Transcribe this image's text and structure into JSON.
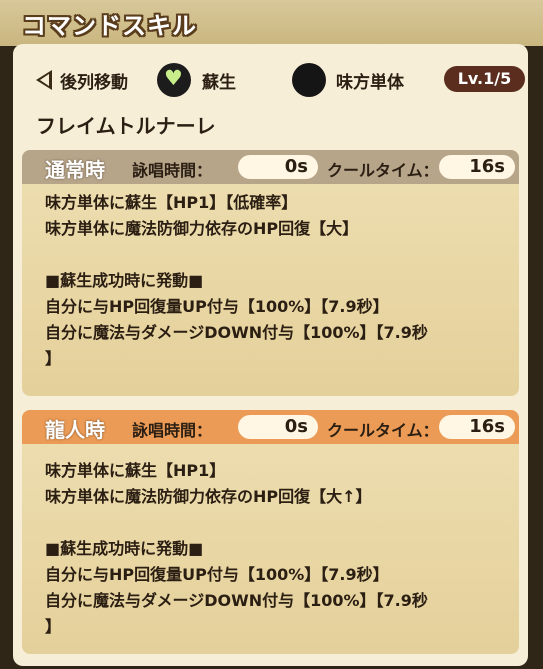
{
  "header": {
    "title": "コマンドスキル"
  },
  "skill": {
    "row_label": "後列移動",
    "effect_label": "蘇生",
    "target_label": "味方単体",
    "level": "Lv.1/5",
    "name": "フレイムトルナーレ"
  },
  "icons": {
    "back": "back-triangle-icon",
    "heart": "heart-icon",
    "target": "target-circle-icon"
  },
  "normal": {
    "mode": "通常時",
    "cast_label": "詠唱時間：",
    "cast_value": "0s",
    "cool_label": "クールタイム：",
    "cool_value": "16s",
    "lines": [
      "味方単体に蘇生【HP1】【低確率】",
      "味方単体に魔法防御力依存のHP回復【大】",
      "■蘇生成功時に発動■",
      "自分に与HP回復量UP付与【100%】【7.9秒】",
      "自分に魔法与ダメージDOWN付与【100%】【7.9秒",
      "】"
    ]
  },
  "dragon": {
    "mode": "龍人時",
    "cast_label": "詠唱時間：",
    "cast_value": "0s",
    "cool_label": "クールタイム：",
    "cool_value": "16s",
    "lines": [
      "味方単体に蘇生【HP1】",
      "味方単体に魔法防御力依存のHP回復【大↑】",
      "■蘇生成功時に発動■",
      "自分に与HP回復量UP付与【100%】【7.9秒】",
      "自分に魔法与ダメージDOWN付与【100%】【7.9秒",
      "】"
    ]
  },
  "colors": {
    "normal_header": "#b7a58a",
    "dragon_header": "#eb9b55",
    "level_badge": "#5b2d1e"
  }
}
